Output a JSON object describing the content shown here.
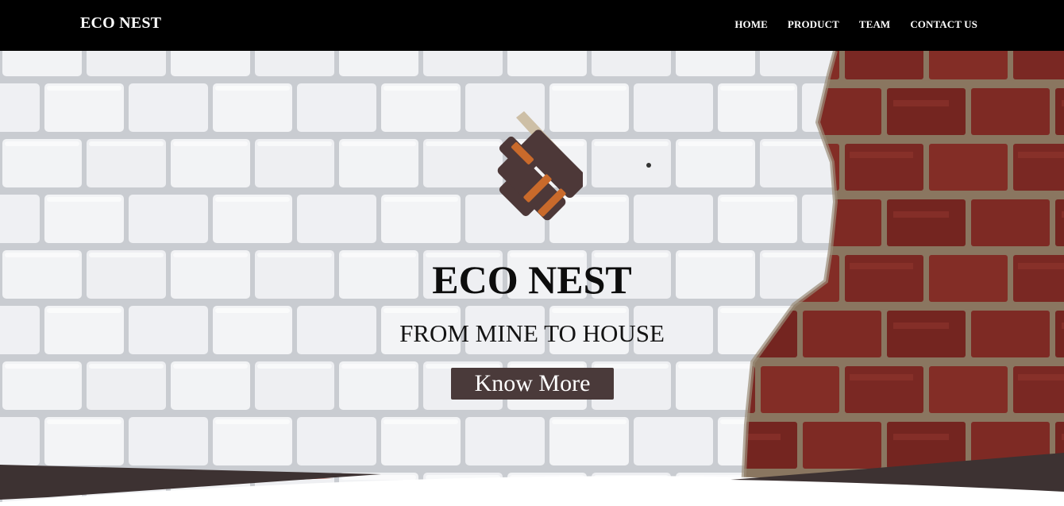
{
  "navbar": {
    "brand": "ECO NEST",
    "links": [
      {
        "label": "HOME"
      },
      {
        "label": "PRODUCT"
      },
      {
        "label": "TEAM"
      },
      {
        "label": "CONTACT US"
      }
    ]
  },
  "hero": {
    "title": "ECO NEST",
    "subtitle": "FROM MINE TO HOUSE",
    "cta_label": "Know More",
    "logo_icon": "brick-pattern-logo-icon",
    "background": "brick-wall-image"
  },
  "colors": {
    "navbar_bg": "#000000",
    "button_bg": "#4a3a3a",
    "logo_dark": "#4d3838",
    "logo_orange": "#c96a2b",
    "logo_tan": "#cdbfa6",
    "red_brick": "#7e2a24",
    "wave_dark": "#3d3232",
    "wave_red": "#a5463a"
  }
}
